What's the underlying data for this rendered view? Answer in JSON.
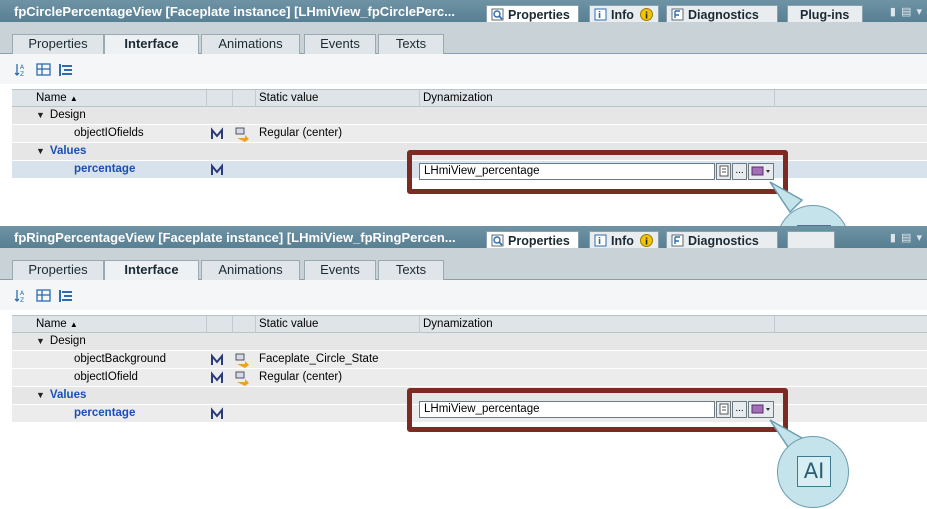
{
  "panels": [
    {
      "title": "fpCirclePercentageView  [Faceplate instance]  [LHmiView_fpCirclePerc...",
      "top_tabs": [
        "Properties",
        "Info",
        "Diagnostics",
        "Plug-ins"
      ],
      "sub_tabs": [
        "Properties",
        "Interface",
        "Animations",
        "Events",
        "Texts"
      ],
      "active_sub_tab": "Interface",
      "columns": [
        "Name",
        "Static value",
        "Dynamization"
      ],
      "groups": [
        {
          "label": "Design",
          "rows": [
            {
              "name": "objectIOfields",
              "static": "Regular (center)"
            }
          ]
        },
        {
          "label": "Values",
          "rows": [
            {
              "name": "percentage",
              "static": "",
              "dynamization": "LHmiView_percentage"
            }
          ]
        }
      ]
    },
    {
      "title": "fpRingPercentageView  [Faceplate instance]  [LHmiView_fpRingPercen...",
      "top_tabs": [
        "Properties",
        "Info",
        "Diagnostics"
      ],
      "sub_tabs": [
        "Properties",
        "Interface",
        "Animations",
        "Events",
        "Texts"
      ],
      "active_sub_tab": "Interface",
      "columns": [
        "Name",
        "Static value",
        "Dynamization"
      ],
      "groups": [
        {
          "label": "Design",
          "rows": [
            {
              "name": "objectBackground",
              "static": "Faceplate_Circle_State"
            },
            {
              "name": "objectIOfield",
              "static": "Regular (center)"
            }
          ]
        },
        {
          "label": "Values",
          "rows": [
            {
              "name": "percentage",
              "static": "",
              "dynamization": "LHmiView_percentage"
            }
          ]
        }
      ]
    }
  ],
  "dyn_button_more": "...",
  "callout_icon": "text-cursor-icon",
  "callout_label": "A",
  "colors": {
    "titlebar": "#6285a3",
    "highlight_frame": "#7b2b22",
    "values_text": "#1a4fb5",
    "callout": "#c5e3ea"
  }
}
